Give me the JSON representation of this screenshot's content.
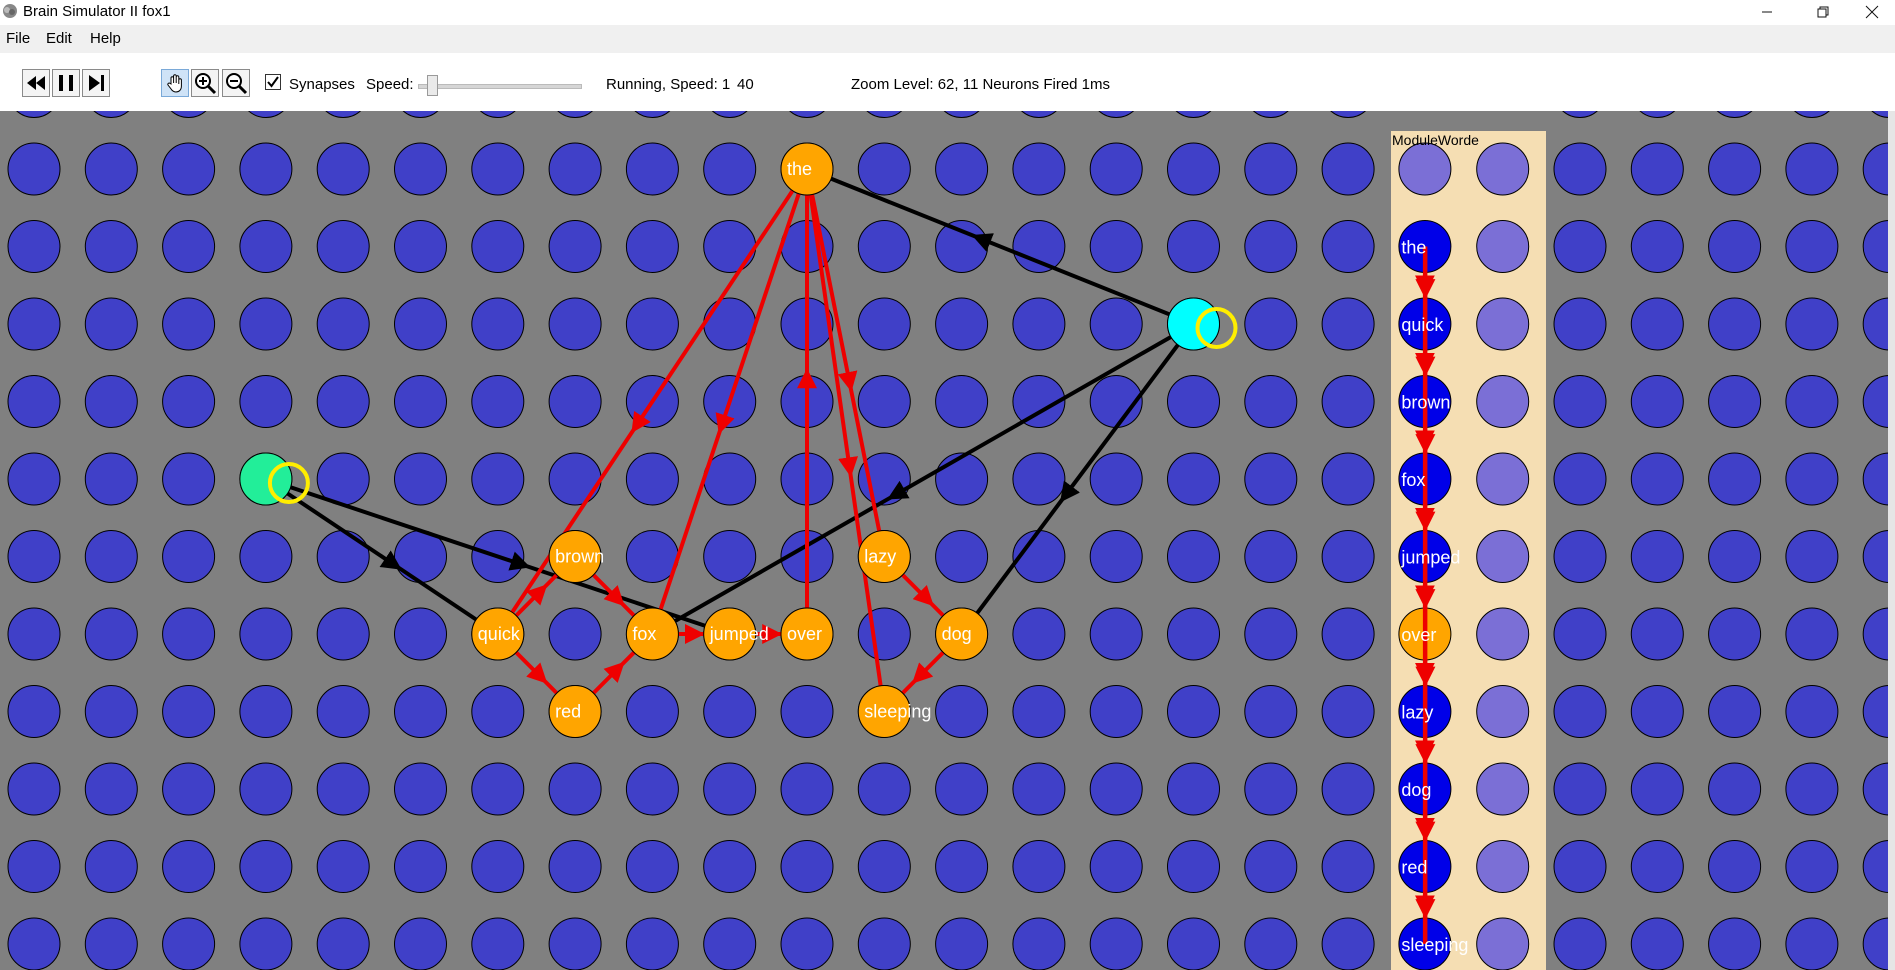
{
  "window": {
    "title": "Brain Simulator II fox1"
  },
  "menu": [
    "File",
    "Edit",
    "Help"
  ],
  "toolbar": {
    "synapses_label": "Synapses",
    "synapses_checked": true,
    "speed_label": "Speed:",
    "status": "Running, Speed: 1",
    "speed_value": "40",
    "info": "Zoom Level: 62,  11 Neurons Fired  1ms",
    "speed_fraction": 0.05
  },
  "module": {
    "label": "ModuleWorde"
  },
  "neurons": [
    {
      "label": "the"
    },
    {
      "label": "quick"
    },
    {
      "label": "brown"
    },
    {
      "label": "fox"
    },
    {
      "label": "jumped"
    },
    {
      "label": "over"
    },
    {
      "label": "lazy"
    },
    {
      "label": "dog"
    },
    {
      "label": "red"
    },
    {
      "label": "sleeping"
    }
  ],
  "module_words": [
    {
      "label": "the"
    },
    {
      "label": "quick"
    },
    {
      "label": "brown"
    },
    {
      "label": "fox"
    },
    {
      "label": "jumped"
    },
    {
      "label": "over"
    },
    {
      "label": "lazy"
    },
    {
      "label": "dog"
    },
    {
      "label": "red"
    },
    {
      "label": "sleeping"
    }
  ],
  "colors": {
    "background": "#808080",
    "neuron_idle": "#4040c8",
    "neuron_fired": "#ffa500",
    "module_bg": "#f5deb3",
    "module_neuron": "#0000e8",
    "module_neuron_light": "#7b6fd6",
    "synapse_positive": "#ee0000",
    "synapse_neutral": "#000000",
    "selected_ring": "#ffee00",
    "neuron_cyan": "#00ffff",
    "neuron_green": "#22ee99"
  }
}
